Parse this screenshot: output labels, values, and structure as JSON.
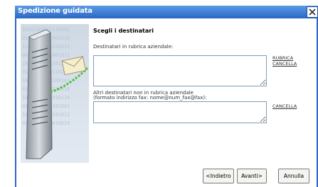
{
  "window": {
    "title": "Spedizione guidata",
    "close_label": "Chiudi"
  },
  "step": {
    "heading": "Scegli i destinatari"
  },
  "internal_recipients": {
    "label": "Destinatari in rubrica aziendale:",
    "value": "",
    "links": {
      "rubrica": "RUBRICA",
      "cancella": "CANCELLA"
    }
  },
  "external_recipients": {
    "label_line1": "Altri destinatari non in rubrica aziendale",
    "label_line2": "(formato indirizzo fax: nome@num_fax@fax):",
    "value": "",
    "links": {
      "cancella": "CANCELLA"
    }
  },
  "buttons": {
    "back": "<Indietro",
    "next": "Avanti>",
    "cancel": "Annulla"
  },
  "colors": {
    "title_bar": "#2a67c6",
    "side_panel": "#dbe5f0",
    "field_border": "#7f9db9"
  },
  "icons": {
    "close": "close-icon",
    "illustration": "server-fax-envelope-illustration"
  }
}
